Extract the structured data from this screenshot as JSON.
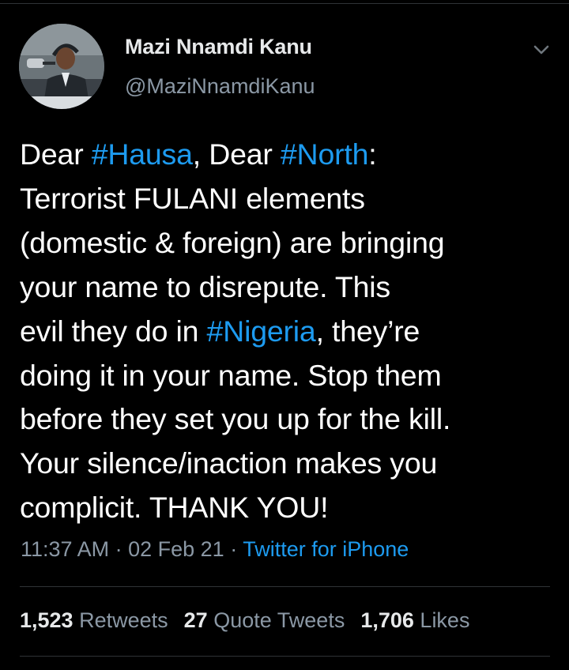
{
  "tweet": {
    "author_name": "Mazi Nnamdi Kanu",
    "author_handle": "@MaziNnamdiKanu",
    "body_lines": [
      [
        {
          "t": "Dear "
        },
        {
          "t": "#Hausa",
          "tag": true
        },
        {
          "t": ", Dear "
        },
        {
          "t": "#North",
          "tag": true
        },
        {
          "t": ":"
        }
      ],
      [
        {
          "t": "Terrorist FULANI elements"
        }
      ],
      [
        {
          "t": "(domestic & foreign) are bringing"
        }
      ],
      [
        {
          "t": "your name to disrepute. This"
        }
      ],
      [
        {
          "t": "evil they do in "
        },
        {
          "t": "#Nigeria",
          "tag": true
        },
        {
          "t": ", they’re"
        }
      ],
      [
        {
          "t": "doing it in your name. Stop them"
        }
      ],
      [
        {
          "t": "before they set you up for the kill."
        }
      ],
      [
        {
          "t": "Your silence/inaction makes you"
        }
      ],
      [
        {
          "t": "complicit. THANK YOU!"
        }
      ]
    ],
    "time": "11:37 AM",
    "separator": "·",
    "date": "02 Feb 21",
    "source": "Twitter for iPhone"
  },
  "stats": {
    "retweets_count": "1,523",
    "retweets_label": "Retweets",
    "quotes_count": "27",
    "quotes_label": "Quote Tweets",
    "likes_count": "1,706",
    "likes_label": "Likes"
  },
  "icons": {
    "menu": "chevron-down-icon"
  },
  "colors": {
    "background": "#000000",
    "text": "#ffffff",
    "muted": "#8b98a5",
    "link": "#1d9bf0",
    "divider": "#2f3336"
  }
}
